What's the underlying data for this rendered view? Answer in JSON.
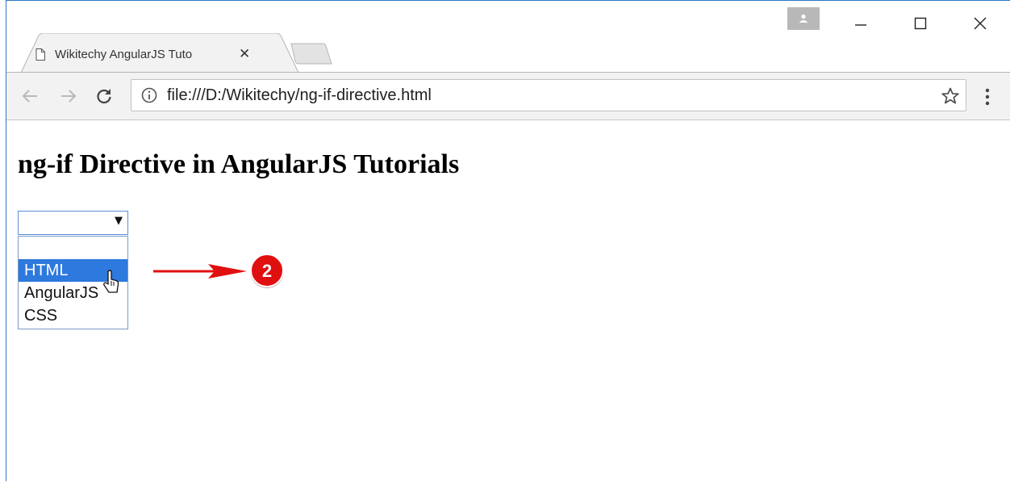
{
  "browser": {
    "tab_title": "Wikitechy AngularJS Tuto",
    "close_glyph": "✕",
    "url": "file:///D:/Wikitechy/ng-if-directive.html",
    "controls": {
      "minimize": "—",
      "maximize": "☐",
      "close": "✕"
    },
    "nav": {
      "back": "←",
      "forward": "→",
      "reload": "C"
    },
    "menu_glyph": "⋮"
  },
  "page": {
    "heading": "ng-if Directive in AngularJS Tutorials",
    "select": {
      "current_value": "",
      "options": [
        "",
        "HTML",
        "AngularJS",
        "CSS"
      ],
      "highlighted": "HTML"
    }
  },
  "annotation": {
    "step_number": "2",
    "accent_color": "#e01010"
  }
}
